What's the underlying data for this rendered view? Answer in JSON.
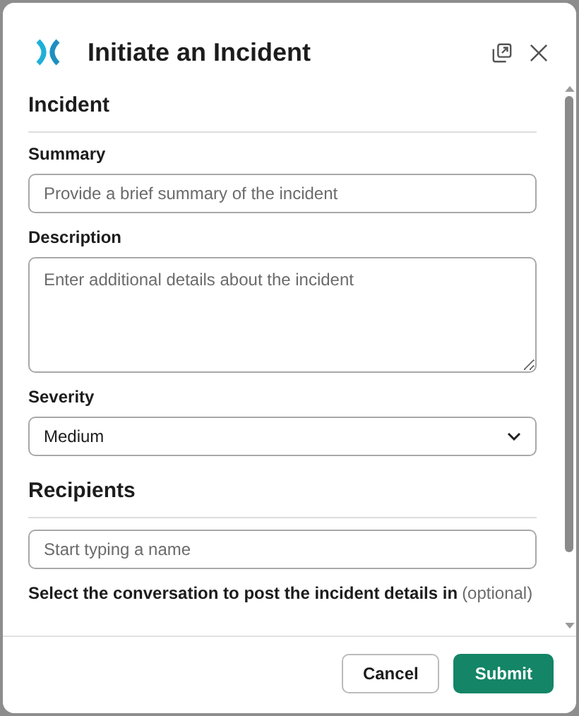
{
  "dialog": {
    "title": "Initiate an Incident"
  },
  "sections": [
    {
      "heading": "Incident",
      "fields": [
        {
          "kind": "input",
          "label": "Summary",
          "placeholder": "Provide a brief summary of the incident"
        },
        {
          "kind": "textarea",
          "label": "Description",
          "placeholder": "Enter additional details about the incident"
        },
        {
          "kind": "select",
          "label": "Severity",
          "value": "Medium"
        }
      ]
    },
    {
      "heading": "Recipients",
      "fields": [
        {
          "kind": "input",
          "placeholder": "Start typing a name"
        },
        {
          "kind": "note",
          "label": "Select the conversation to post the incident details in",
          "hint": "(optional)"
        }
      ]
    }
  ],
  "buttons": [
    {
      "kind": "secondary",
      "label": "Cancel"
    },
    {
      "kind": "primary",
      "label": "Submit"
    }
  ]
}
